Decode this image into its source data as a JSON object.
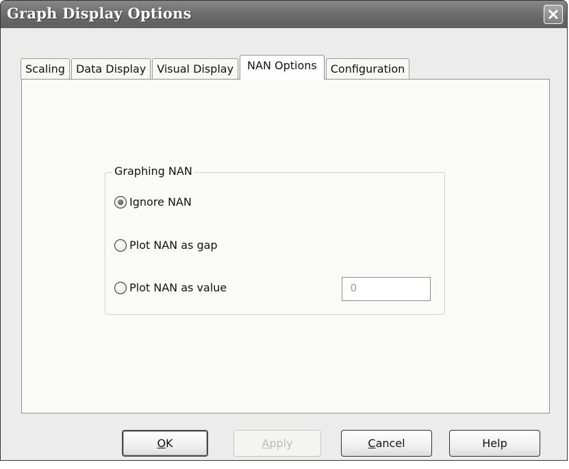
{
  "window": {
    "title": "Graph Display Options"
  },
  "tabs": [
    {
      "label": "Scaling",
      "active": false
    },
    {
      "label": "Data Display",
      "active": false
    },
    {
      "label": "Visual Display",
      "active": false
    },
    {
      "label": "NAN Options",
      "active": true
    },
    {
      "label": "Configuration",
      "active": false
    }
  ],
  "group": {
    "label": "Graphing NAN",
    "options": [
      {
        "label": "Ignore NAN",
        "selected": true
      },
      {
        "label": "Plot NAN as gap",
        "selected": false
      },
      {
        "label": "Plot NAN as value",
        "selected": false
      }
    ],
    "value_field": "0"
  },
  "buttons": {
    "ok": {
      "underline": "O",
      "rest": "K"
    },
    "apply": {
      "underline": "A",
      "rest": "pply",
      "disabled": true
    },
    "cancel": {
      "underline": "C",
      "rest": "ancel"
    },
    "help": {
      "label": "Help"
    }
  },
  "icons": {
    "close": "close-icon"
  }
}
